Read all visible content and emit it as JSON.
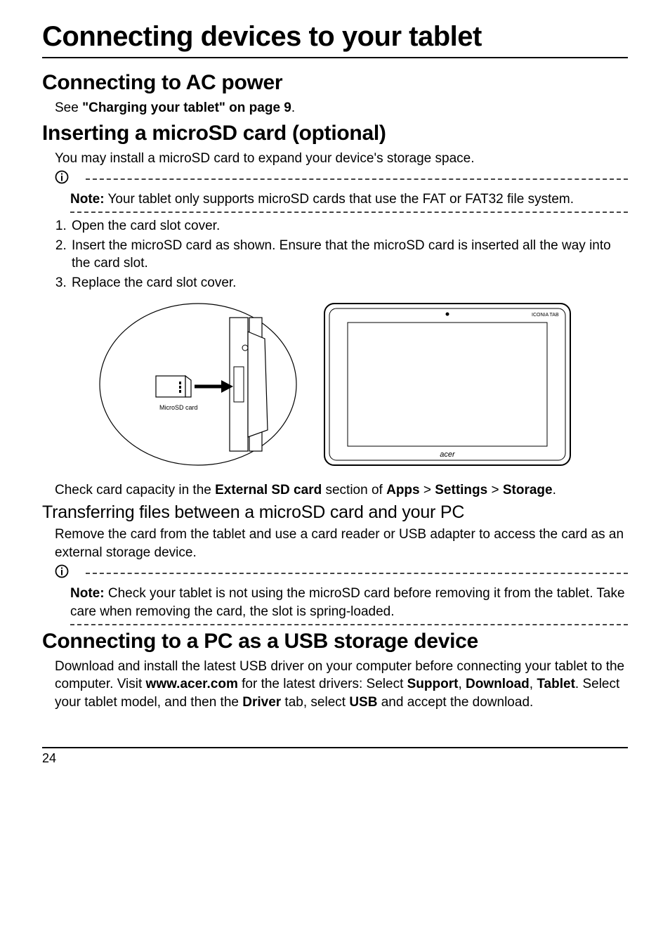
{
  "title": "Connecting devices to your tablet",
  "sec1": {
    "heading": "Connecting to AC power",
    "see": "See ",
    "cross_ref": "\"Charging your tablet\" on page 9",
    "see_end": "."
  },
  "sec2": {
    "heading": "Inserting a microSD card (optional)",
    "intro": "You may install a microSD card to expand your device's storage space.",
    "note_label": "Note:",
    "note_body": " Your tablet only supports microSD cards that use the FAT or FAT32 file system.",
    "steps": [
      "Open the card slot cover.",
      "Insert the microSD card as shown. Ensure that the microSD card is inserted all the way into the card slot.",
      "Replace the card slot cover."
    ],
    "figure_label": "MicroSD card",
    "tablet_brand": "acer",
    "check1": "Check card capacity in the ",
    "check_b1": "External SD card",
    "check2": " section of ",
    "check_b2": "Apps",
    "gt1": " > ",
    "check_b3": "Settings",
    "gt2": " > ",
    "check_b4": "Storage",
    "check_end": "."
  },
  "sec3": {
    "heading": "Transferring files between a microSD card and your PC",
    "body": "Remove the card from the tablet and use a card reader or USB adapter to access the card as an external storage device.",
    "note_label": "Note:",
    "note_body": " Check your tablet is not using the microSD card before removing it from the tablet. Take care when removing the card, the slot is spring-loaded."
  },
  "sec4": {
    "heading": "Connecting to a PC as a USB storage device",
    "p1": "Download and install the latest USB driver on your computer before connecting your tablet to the computer. Visit ",
    "b1": "www.acer.com",
    "p2": " for the latest drivers: Select ",
    "b2": "Support",
    "c1": ", ",
    "b3": "Download",
    "c2": ", ",
    "b4": "Tablet",
    "p3": ". Select your tablet model, and then the ",
    "b5": "Driver",
    "p4": " tab, select ",
    "b6": "USB",
    "p5": " and accept the download."
  },
  "page_number": "24"
}
